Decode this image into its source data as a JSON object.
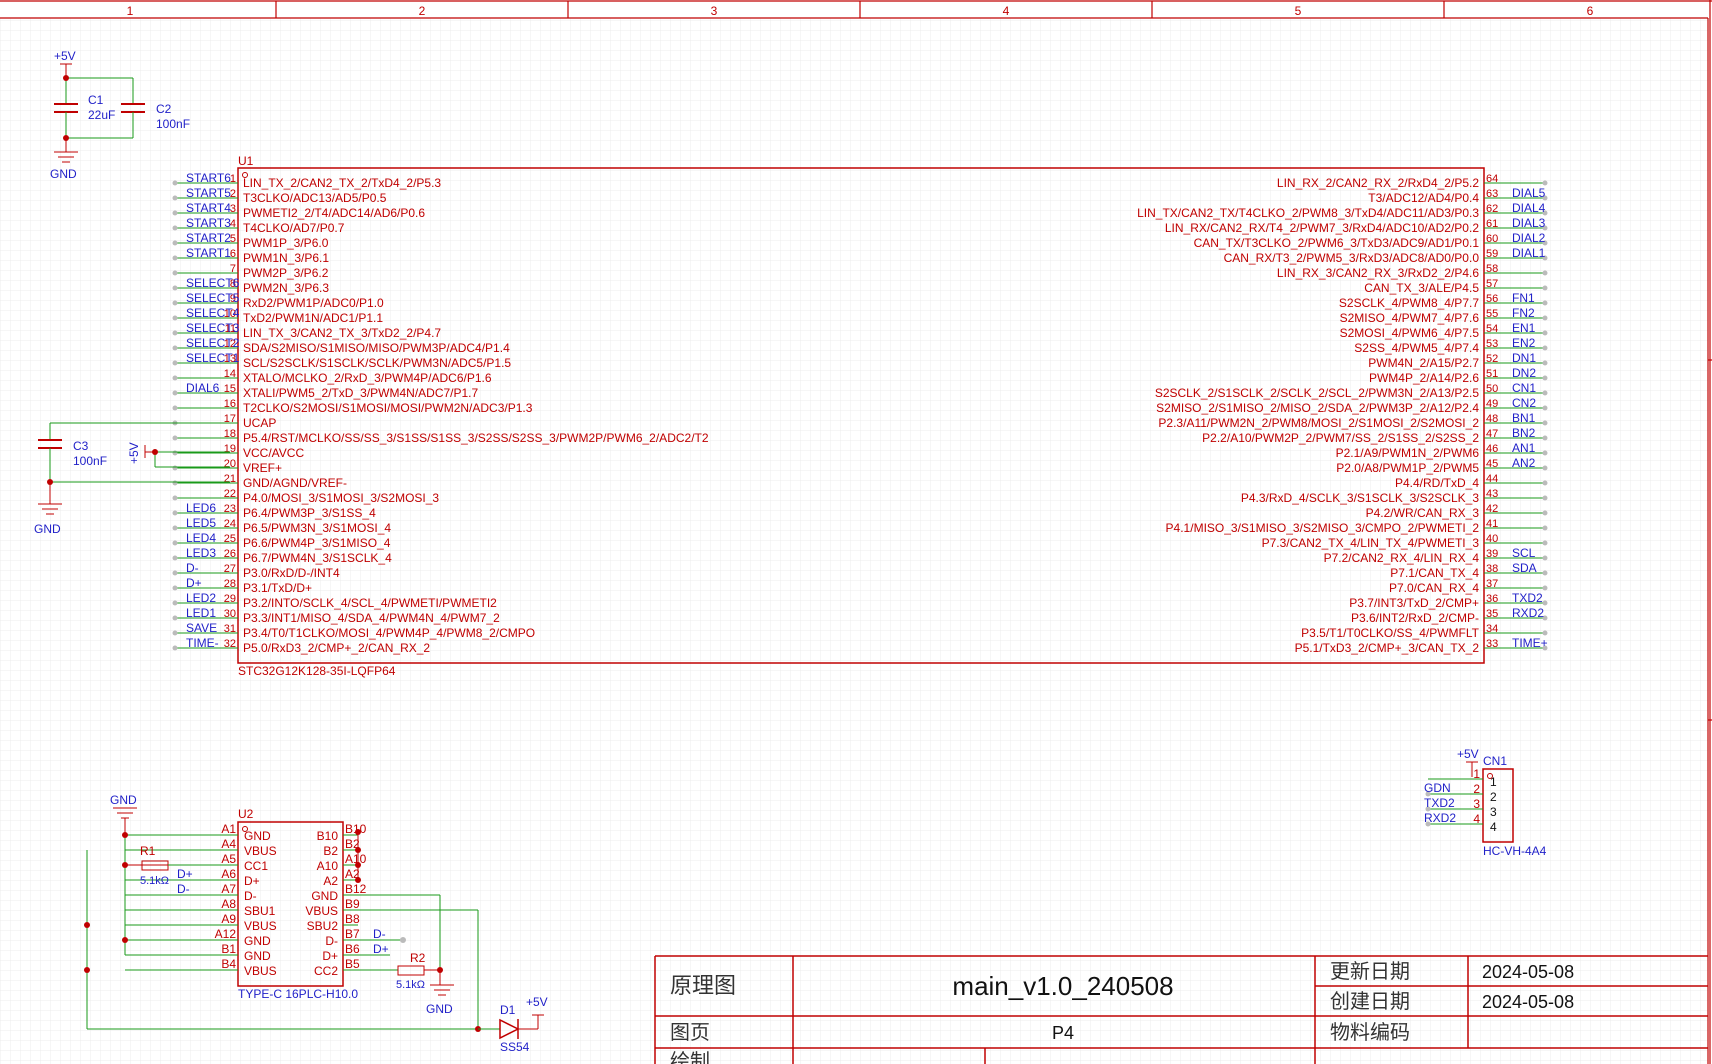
{
  "border": {
    "columns": [
      "1",
      "2",
      "3",
      "4",
      "5",
      "6"
    ]
  },
  "power_net": "+5V",
  "ground_net": "GND",
  "caps": {
    "c1": {
      "ref": "C1",
      "value": "22uF"
    },
    "c2": {
      "ref": "C2",
      "value": "100nF"
    },
    "c3": {
      "ref": "C3",
      "value": "100nF"
    }
  },
  "u1": {
    "ref": "U1",
    "part": "STC32G12K128-35I-LQFP64",
    "left_pins": [
      {
        "num": "1",
        "name": "LIN_TX_2/CAN2_TX_2/TxD4_2/P5.3",
        "net": "START6"
      },
      {
        "num": "2",
        "name": "T3CLKO/ADC13/AD5/P0.5",
        "net": "START5"
      },
      {
        "num": "3",
        "name": "PWMETI2_2/T4/ADC14/AD6/P0.6",
        "net": "START4"
      },
      {
        "num": "4",
        "name": "T4CLKO/AD7/P0.7",
        "net": "START3"
      },
      {
        "num": "5",
        "name": "PWM1P_3/P6.0",
        "net": "START2"
      },
      {
        "num": "6",
        "name": "PWM1N_3/P6.1",
        "net": "START1"
      },
      {
        "num": "7",
        "name": "PWM2P_3/P6.2",
        "net": ""
      },
      {
        "num": "8",
        "name": "PWM2N_3/P6.3",
        "net": "SELECT6"
      },
      {
        "num": "9",
        "name": "RxD2/PWM1P/ADC0/P1.0",
        "net": "SELECT5"
      },
      {
        "num": "10",
        "name": "TxD2/PWM1N/ADC1/P1.1",
        "net": "SELECT4"
      },
      {
        "num": "11",
        "name": "LIN_TX_3/CAN2_TX_3/TxD2_2/P4.7",
        "net": "SELECT3"
      },
      {
        "num": "12",
        "name": "SDA/S2MISO/S1MISO/MISO/PWM3P/ADC4/P1.4",
        "net": "SELECT2"
      },
      {
        "num": "13",
        "name": "SCL/S2SCLK/S1SCLK/SCLK/PWM3N/ADC5/P1.5",
        "net": "SELECT1"
      },
      {
        "num": "14",
        "name": "XTALO/MCLKO_2/RxD_3/PWM4P/ADC6/P1.6",
        "net": ""
      },
      {
        "num": "15",
        "name": "XTALI/PWM5_2/TxD_3/PWM4N/ADC7/P1.7",
        "net": "DIAL6"
      },
      {
        "num": "16",
        "name": "T2CLKO/S2MOSI/S1MOSI/MOSI/PWM2N/ADC3/P1.3",
        "net": ""
      },
      {
        "num": "17",
        "name": "UCAP",
        "net": ""
      },
      {
        "num": "18",
        "name": "P5.4/RST/MCLKO/SS/SS_3/S1SS/S1SS_3/S2SS/S2SS_3/PWM2P/PWM6_2/ADC2/T2",
        "net": ""
      },
      {
        "num": "19",
        "name": "VCC/AVCC",
        "net": ""
      },
      {
        "num": "20",
        "name": "VREF+",
        "net": ""
      },
      {
        "num": "21",
        "name": "GND/AGND/VREF-",
        "net": ""
      },
      {
        "num": "22",
        "name": "P4.0/MOSI_3/S1MOSI_3/S2MOSI_3",
        "net": ""
      },
      {
        "num": "23",
        "name": "P6.4/PWM3P_3/S1SS_4",
        "net": "LED6"
      },
      {
        "num": "24",
        "name": "P6.5/PWM3N_3/S1MOSI_4",
        "net": "LED5"
      },
      {
        "num": "25",
        "name": "P6.6/PWM4P_3/S1MISO_4",
        "net": "LED4"
      },
      {
        "num": "26",
        "name": "P6.7/PWM4N_3/S1SCLK_4",
        "net": "LED3"
      },
      {
        "num": "27",
        "name": "P3.0/RxD/D-/INT4",
        "net": "D-"
      },
      {
        "num": "28",
        "name": "P3.1/TxD/D+",
        "net": "D+"
      },
      {
        "num": "29",
        "name": "P3.2/INTO/SCLK_4/SCL_4/PWMETI/PWMETI2",
        "net": "LED2"
      },
      {
        "num": "30",
        "name": "P3.3/INT1/MISO_4/SDA_4/PWM4N_4/PWM7_2",
        "net": "LED1"
      },
      {
        "num": "31",
        "name": "P3.4/T0/T1CLKO/MOSI_4/PWM4P_4/PWM8_2/CMPO",
        "net": "SAVE"
      },
      {
        "num": "32",
        "name": "P5.0/RxD3_2/CMP+_2/CAN_RX_2",
        "net": "TIME-"
      }
    ],
    "right_pins": [
      {
        "num": "64",
        "name": "LIN_RX_2/CAN2_RX_2/RxD4_2/P5.2",
        "net": ""
      },
      {
        "num": "63",
        "name": "T3/ADC12/AD4/P0.4",
        "net": "DIAL5"
      },
      {
        "num": "62",
        "name": "LIN_TX/CAN2_TX/T4CLKO_2/PWM8_3/TxD4/ADC11/AD3/P0.3",
        "net": "DIAL4"
      },
      {
        "num": "61",
        "name": "LIN_RX/CAN2_RX/T4_2/PWM7_3/RxD4/ADC10/AD2/P0.2",
        "net": "DIAL3"
      },
      {
        "num": "60",
        "name": "CAN_TX/T3CLKO_2/PWM6_3/TxD3/ADC9/AD1/P0.1",
        "net": "DIAL2"
      },
      {
        "num": "59",
        "name": "CAN_RX/T3_2/PWM5_3/RxD3/ADC8/AD0/P0.0",
        "net": "DIAL1"
      },
      {
        "num": "58",
        "name": "LIN_RX_3/CAN2_RX_3/RxD2_2/P4.6",
        "net": ""
      },
      {
        "num": "57",
        "name": "CAN_TX_3/ALE/P4.5",
        "net": ""
      },
      {
        "num": "56",
        "name": "S2SCLK_4/PWM8_4/P7.7",
        "net": "FN1"
      },
      {
        "num": "55",
        "name": "S2MISO_4/PWM7_4/P7.6",
        "net": "FN2"
      },
      {
        "num": "54",
        "name": "S2MOSI_4/PWM6_4/P7.5",
        "net": "EN1"
      },
      {
        "num": "53",
        "name": "S2SS_4/PWM5_4/P7.4",
        "net": "EN2"
      },
      {
        "num": "52",
        "name": "PWM4N_2/A15/P2.7",
        "net": "DN1"
      },
      {
        "num": "51",
        "name": "PWM4P_2/A14/P2.6",
        "net": "DN2"
      },
      {
        "num": "50",
        "name": "S2SCLK_2/S1SCLK_2/SCLK_2/SCL_2/PWM3N_2/A13/P2.5",
        "net": "CN1"
      },
      {
        "num": "49",
        "name": "S2MISO_2/S1MISO_2/MISO_2/SDA_2/PWM3P_2/A12/P2.4",
        "net": "CN2"
      },
      {
        "num": "48",
        "name": "P2.3/A11/PWM2N_2/PWM8/MOSI_2/S1MOSI_2/S2MOSI_2",
        "net": "BN1"
      },
      {
        "num": "47",
        "name": "P2.2/A10/PWM2P_2/PWM7/SS_2/S1SS_2/S2SS_2",
        "net": "BN2"
      },
      {
        "num": "46",
        "name": "P2.1/A9/PWM1N_2/PWM6",
        "net": "AN1"
      },
      {
        "num": "45",
        "name": "P2.0/A8/PWM1P_2/PWM5",
        "net": "AN2"
      },
      {
        "num": "44",
        "name": "P4.4/RD/TxD_4",
        "net": ""
      },
      {
        "num": "43",
        "name": "P4.3/RxD_4/SCLK_3/S1SCLK_3/S2SCLK_3",
        "net": ""
      },
      {
        "num": "42",
        "name": "P4.2/WR/CAN_RX_3",
        "net": ""
      },
      {
        "num": "41",
        "name": "P4.1/MISO_3/S1MISO_3/S2MISO_3/CMPO_2/PWMETI_2",
        "net": ""
      },
      {
        "num": "40",
        "name": "P7.3/CAN2_TX_4/LIN_TX_4/PWMETI_3",
        "net": ""
      },
      {
        "num": "39",
        "name": "P7.2/CAN2_RX_4/LIN_RX_4",
        "net": "SCL"
      },
      {
        "num": "38",
        "name": "P7.1/CAN_TX_4",
        "net": "SDA"
      },
      {
        "num": "37",
        "name": "P7.0/CAN_RX_4",
        "net": ""
      },
      {
        "num": "36",
        "name": "P3.7/INT3/TxD_2/CMP+",
        "net": "TXD2"
      },
      {
        "num": "35",
        "name": "P3.6/INT2/RxD_2/CMP-",
        "net": "RXD2"
      },
      {
        "num": "34",
        "name": "P3.5/T1/T0CLKO/SS_4/PWMFLT",
        "net": ""
      },
      {
        "num": "33",
        "name": "P5.1/TxD3_2/CMP+_3/CAN_TX_2",
        "net": "TIME+"
      }
    ]
  },
  "u2": {
    "ref": "U2",
    "part": "TYPE-C 16PLC-H10.0",
    "left_pins": [
      {
        "num": "A1",
        "name": "GND"
      },
      {
        "num": "A4",
        "name": "VBUS"
      },
      {
        "num": "A5",
        "name": "CC1"
      },
      {
        "num": "A6",
        "name": "D+"
      },
      {
        "num": "A7",
        "name": "D-"
      },
      {
        "num": "A8",
        "name": "SBU1"
      },
      {
        "num": "A9",
        "name": "VBUS"
      },
      {
        "num": "A12",
        "name": "GND"
      },
      {
        "num": "B1",
        "name": "GND"
      },
      {
        "num": "B4",
        "name": "VBUS"
      }
    ],
    "right_pins": [
      {
        "num": "B10",
        "name": "B10"
      },
      {
        "num": "B2",
        "name": "B2"
      },
      {
        "num": "A10",
        "name": "A10"
      },
      {
        "num": "A2",
        "name": "A2"
      },
      {
        "num": "B12",
        "name": "GND"
      },
      {
        "num": "B9",
        "name": "VBUS"
      },
      {
        "num": "B8",
        "name": "SBU2"
      },
      {
        "num": "B7",
        "name": "D-"
      },
      {
        "num": "B6",
        "name": "D+"
      },
      {
        "num": "B5",
        "name": "CC2"
      }
    ],
    "net_labels": {
      "dp": "D+",
      "dm": "D-"
    }
  },
  "r1": {
    "ref": "R1",
    "value": "5.1kΩ"
  },
  "r2": {
    "ref": "R2",
    "value": "5.1kΩ"
  },
  "d1": {
    "ref": "D1",
    "part": "SS54"
  },
  "cn1": {
    "ref": "CN1",
    "part": "HC-VH-4A4",
    "pins": [
      {
        "num": "1",
        "inner": "1",
        "net": ""
      },
      {
        "num": "2",
        "inner": "2",
        "net": "GDN"
      },
      {
        "num": "3",
        "inner": "3",
        "net": "TXD2"
      },
      {
        "num": "4",
        "inner": "4",
        "net": "RXD2"
      }
    ]
  },
  "title_block": {
    "type_label": "原理图",
    "title": "main_v1.0_240508",
    "update_label": "更新日期",
    "update_date": "2024-05-08",
    "create_label": "创建日期",
    "create_date": "2024-05-08",
    "page_label": "图页",
    "page_value": "P4",
    "material_label": "物料编码",
    "drawn_label": "绘制"
  }
}
